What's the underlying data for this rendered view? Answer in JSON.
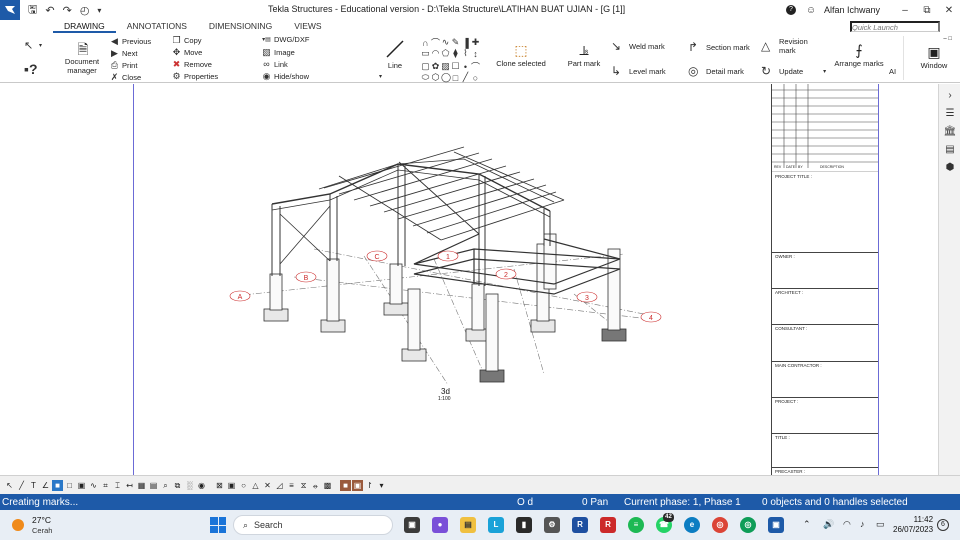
{
  "titlebar": {
    "title": "Tekla Structures - Educational version - D:\\Tekla Structure\\LATIHAN BUAT UJIAN - [G [1]]",
    "user": "Alfan Ichwany",
    "help_icon": "?",
    "user_icon": "user-icon"
  },
  "tabs": [
    {
      "label": "DRAWING",
      "active": true
    },
    {
      "label": "ANNOTATIONS",
      "active": false
    },
    {
      "label": "DIMENSIONING",
      "active": false
    },
    {
      "label": "VIEWS",
      "active": false
    }
  ],
  "quick_launch": {
    "placeholder": "Quick Launch"
  },
  "ribbon": {
    "document_manager": "Document manager",
    "previous": "Previous",
    "next": "Next",
    "print": "Print",
    "close": "Close",
    "copy": "Copy",
    "move": "Move",
    "remove": "Remove",
    "properties": "Properties",
    "dwg_dxf": "DWG/DXF",
    "image": "Image",
    "link": "Link",
    "hide_show": "Hide/show",
    "line": "Line",
    "clone_selected": "Clone selected",
    "part_mark": "Part mark",
    "weld_mark": "Weld mark",
    "level_mark": "Level mark",
    "section_mark": "Section mark",
    "detail_mark": "Detail mark",
    "revision_mark": "Revision mark",
    "update": "Update",
    "arrange_marks": "Arrange marks",
    "ai": "AI",
    "window": "Window"
  },
  "drawing": {
    "view_name": "3d",
    "view_scale": "1:100",
    "grid_labels": [
      "A",
      "B",
      "C",
      "1",
      "2",
      "3",
      "4"
    ]
  },
  "titleblock": {
    "header_cols": [
      "REV",
      "DATE",
      "BY",
      "DESCRIPTION"
    ],
    "project_title": "PROJECT TITLE :",
    "owner": "OWNER :",
    "architect": "ARCHITECT :",
    "consultant": "CONSULTANT :",
    "main_contractor": "MAIN CONTRACTOR :",
    "project": "PROJECT :",
    "title": "TITLE :",
    "precaster": "PRECASTER :"
  },
  "status": {
    "message": "Creating marks...",
    "od": "O d",
    "pan": "0  Pan",
    "phase": "Current phase: 1, Phase 1",
    "selection": "0 objects and 0 handles selected"
  },
  "taskbar": {
    "temperature": "27°C",
    "weather": "Cerah",
    "search": "Search",
    "time": "11:42",
    "date": "26/07/2023",
    "notifications": "6",
    "badge": "42"
  },
  "colors": {
    "accent": "#1e5aa8",
    "status_bar": "#1e5aa8",
    "grid_label": "#cc2a2a",
    "view_border": "#6b6bd6"
  }
}
